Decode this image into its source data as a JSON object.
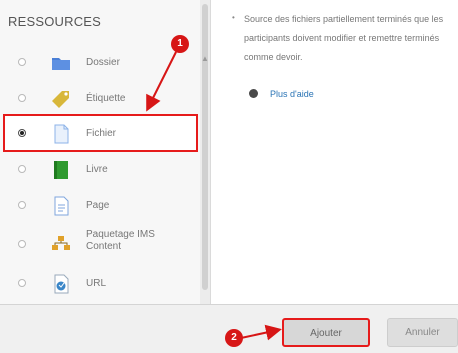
{
  "sidebar": {
    "title": "RESSOURCES",
    "items": [
      {
        "label": "Dossier",
        "icon": "folder-icon"
      },
      {
        "label": "Étiquette",
        "icon": "tag-icon"
      },
      {
        "label": "Fichier",
        "icon": "file-icon"
      },
      {
        "label": "Livre",
        "icon": "book-icon"
      },
      {
        "label": "Page",
        "icon": "page-icon"
      },
      {
        "label": "Paquetage IMS Content",
        "icon": "package-icon"
      },
      {
        "label": "URL",
        "icon": "url-icon"
      }
    ],
    "selected": "Fichier"
  },
  "description": {
    "text": "Source des fichiers partiellement terminés que les participants doivent modifier et remettre terminés comme devoir.",
    "help_link": "Plus d'aide"
  },
  "footer": {
    "add_label": "Ajouter",
    "cancel_label": "Annuler"
  },
  "annotations": {
    "badge_1": "1",
    "badge_2": "2"
  },
  "colors": {
    "highlight": "#e61b1b",
    "folder": "#4a7fd6",
    "tag": "#d8b73a",
    "file": "#8db3e8",
    "book": "#2f9a2f",
    "link": "#2a74b5"
  }
}
